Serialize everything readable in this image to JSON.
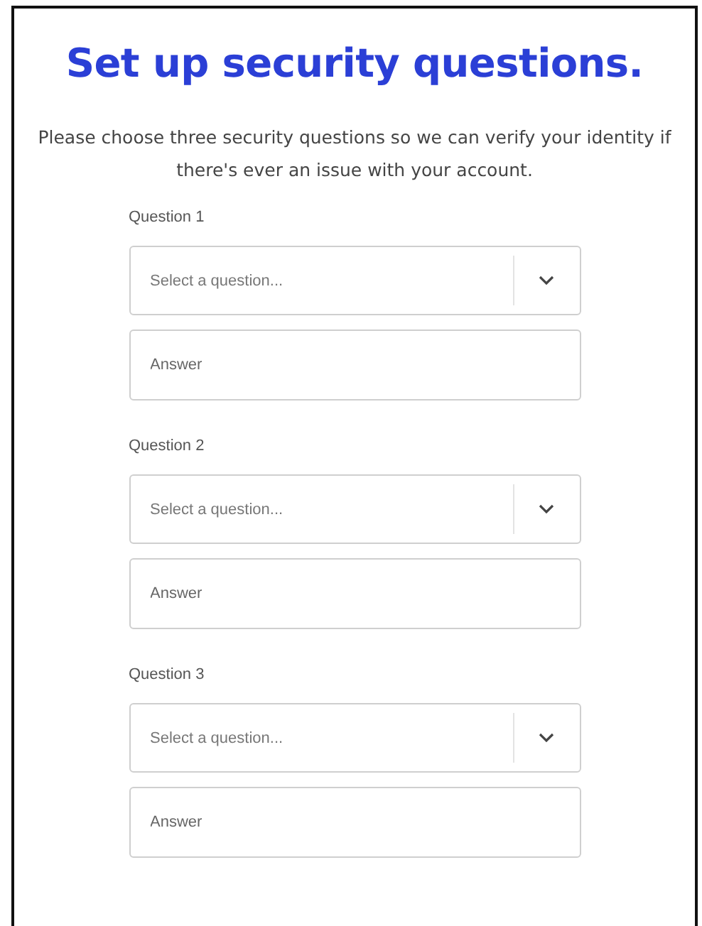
{
  "title": "Set up security questions.",
  "intro": "Please choose three security questions so we can verify your identity if there's ever an issue with your account.",
  "questions": [
    {
      "label": "Question 1",
      "select": {
        "placeholder": "Select a question..."
      },
      "answer": {
        "placeholder": "Answer"
      }
    },
    {
      "label": "Question 2",
      "select": {
        "placeholder": "Select a question..."
      },
      "answer": {
        "placeholder": "Answer"
      }
    },
    {
      "label": "Question 3",
      "select": {
        "placeholder": "Select a question..."
      },
      "answer": {
        "placeholder": "Answer"
      }
    }
  ]
}
